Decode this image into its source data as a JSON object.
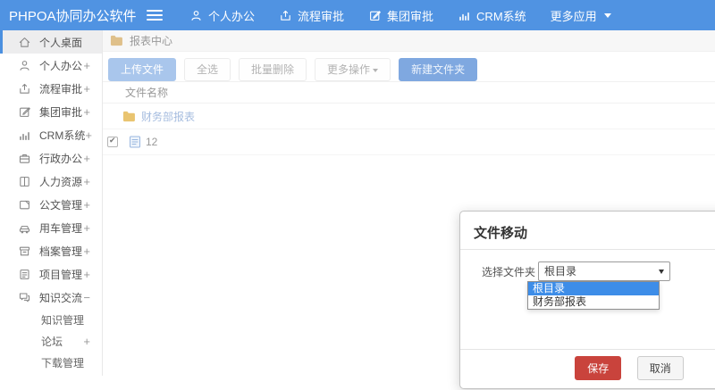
{
  "header": {
    "logo": "PHPOA协同办公软件",
    "nav": [
      {
        "label": "个人办公",
        "icon": "user-icon"
      },
      {
        "label": "流程审批",
        "icon": "process-icon"
      },
      {
        "label": "集团审批",
        "icon": "edit-icon"
      },
      {
        "label": "CRM系统",
        "icon": "bar-chart-icon"
      },
      {
        "label": "更多应用",
        "icon": "caret-down-icon"
      }
    ]
  },
  "sidebar": {
    "items": [
      {
        "label": "个人桌面",
        "suffix": "",
        "active": true
      },
      {
        "label": "个人办公",
        "suffix": "+"
      },
      {
        "label": "流程审批",
        "suffix": "+"
      },
      {
        "label": "集团审批",
        "suffix": "+"
      },
      {
        "label": "CRM系统",
        "suffix": "+"
      },
      {
        "label": "行政办公",
        "suffix": "+"
      },
      {
        "label": "人力资源",
        "suffix": "+"
      },
      {
        "label": "公文管理",
        "suffix": "+"
      },
      {
        "label": "用车管理",
        "suffix": "+"
      },
      {
        "label": "档案管理",
        "suffix": "+"
      },
      {
        "label": "项目管理",
        "suffix": "+"
      },
      {
        "label": "知识交流",
        "suffix": "−"
      }
    ],
    "subitems": [
      {
        "label": "知识管理",
        "suffix": ""
      },
      {
        "label": "论坛",
        "suffix": "+"
      },
      {
        "label": "下载管理",
        "suffix": ""
      }
    ]
  },
  "breadcrumb": {
    "title": "报表中心"
  },
  "toolbar": {
    "upload": "上传文件",
    "select_all": "全选",
    "batch_delete": "批量删除",
    "more_actions": "更多操作",
    "new_folder": "新建文件夹"
  },
  "files": {
    "header": "文件名称",
    "rows": [
      {
        "name": "财务部报表",
        "type": "folder",
        "checked": false
      },
      {
        "name": "12",
        "type": "file",
        "checked": true
      }
    ]
  },
  "modal": {
    "title": "文件移动",
    "label": "选择文件夹",
    "selected": "根目录",
    "options": [
      "根目录",
      "财务部报表"
    ],
    "save": "保存",
    "cancel": "取消"
  },
  "colors": {
    "header_bg": "#5093e2",
    "primary_button": "#7fa8e0",
    "upload_button": "#a9c6ec",
    "save_red": "#c9433c",
    "dropdown_highlight": "#3d8de8",
    "folder_yellow": "#e9c470",
    "active_item_bg": "#ededee"
  }
}
